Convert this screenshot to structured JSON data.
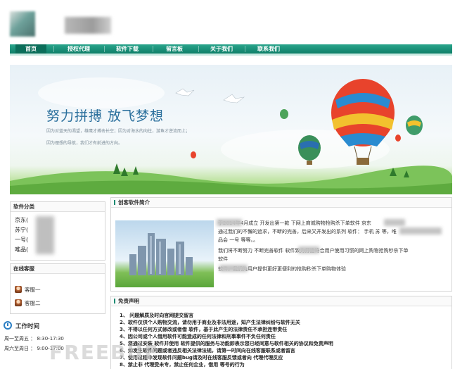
{
  "nav": {
    "items": [
      "首页",
      "授权代理",
      "软件下载",
      "留言板",
      "关于我们",
      "联系我们"
    ]
  },
  "banner": {
    "slogan": "努力拼搏 放飞梦想",
    "sub1": "因为对蓝天的渴望，雄鹰才搏击长空；因为对海水的向往，游鱼才逆流而上；",
    "sub2": "因为理想的导航，我们才有前进的方向。"
  },
  "sidebar": {
    "category_title": "软件分类",
    "categories": [
      "京东(",
      "苏宁(",
      "一号(",
      "唯品("
    ],
    "service_title": "在线客服",
    "service": [
      "客服一",
      "客服二"
    ],
    "work_title": "工作时间",
    "work_hours": [
      "周一至周五 ： 8:30-17:30",
      "周六至周日 ： 9:00-17:00"
    ]
  },
  "intro": {
    "title": "创客软件简介",
    "lines": [
      "于2014年4月成立  开发出第一款        下网上商城购物抢购杀下单软件  京东",
      "通过我们的不懈的追求，不断的完善，后来又开发出的系列      软件：  手机       苏        等，唯",
      "品会        一号        等等。。",
      "我们将不断努力  不断完善软件        软件致力打造符合用户使用习惯的网上购物抢购秒杀下单",
      "软件",
      "         软件，我们为用户提供更好更便利的抢购秒杀下单购物体验"
    ]
  },
  "disclaimer": {
    "title": "免责声明",
    "lines": [
      "1、           问题解质及时向官网提交留言",
      "2、软件仅供个人购物交流，请勿用于商业及非法用途，知产生法律纠纷与软件无关",
      "3、不得以任何方式修改或者借        软件，基于此产生的法律责任不承担连带责任",
      "4、因公司或个人借用软件可能造成的任何法律和刑事事件不负任何责任",
      "5、您通过安装        软件并使用        软件提供的服务与功能即表示您已经同意与软件相关的协议和免责声明",
      "6、如发生软件问题或者违反相关法律法规，请第一时间向在线客服联系或者留言",
      "7、使用过程中发现软件问题bug请及时在线客服反馈或者向         代理代理反应",
      "8、禁止非        代理受未专，禁止任何企业，借用        等号的行为"
    ]
  },
  "watermark": "FREEBUF"
}
